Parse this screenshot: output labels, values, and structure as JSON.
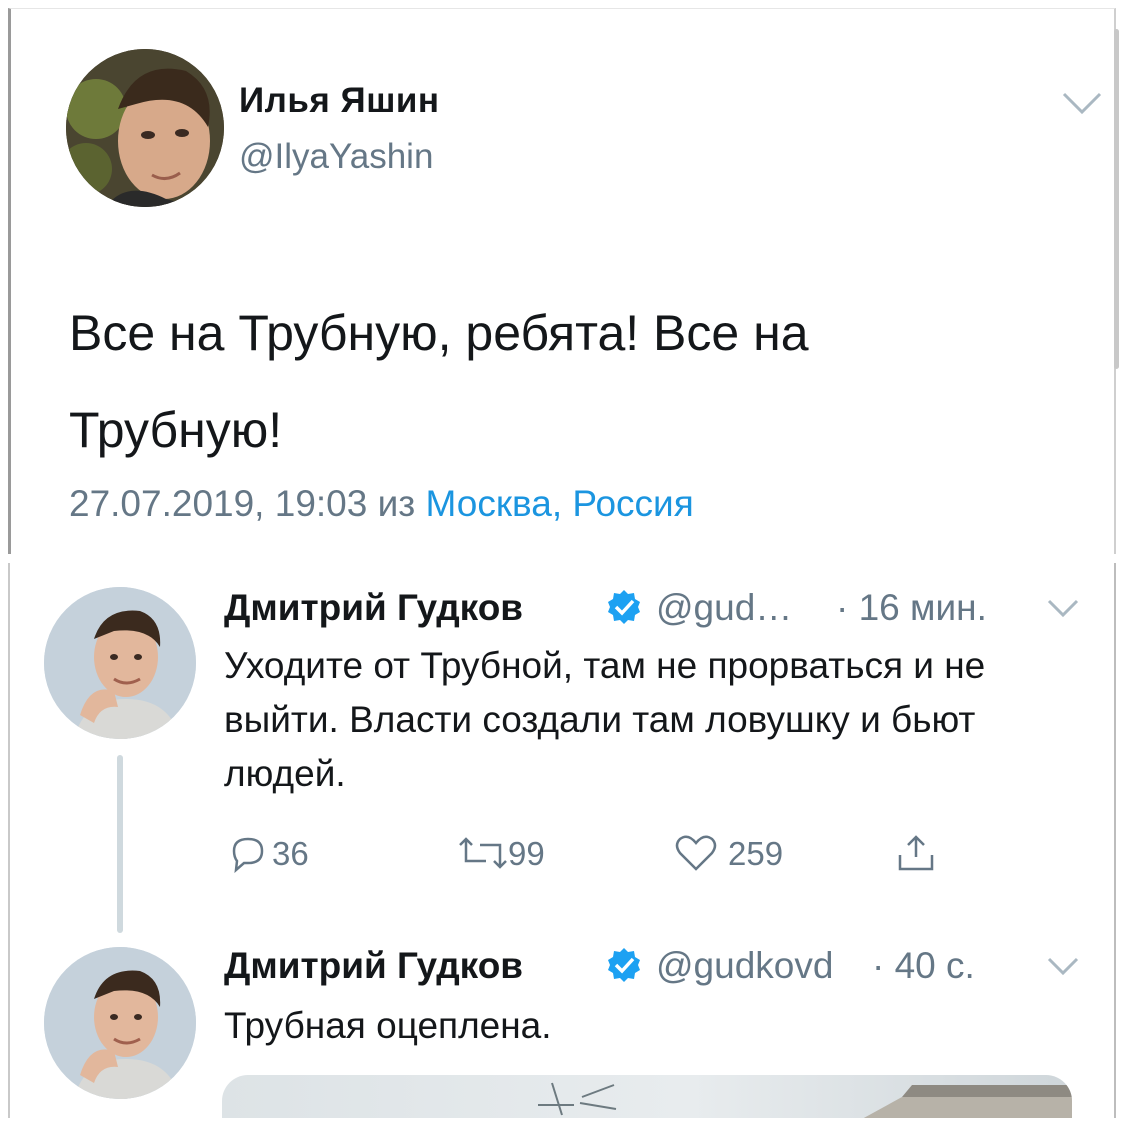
{
  "top_tweet": {
    "name": "Илья Яшин",
    "handle": "@IlyaYashin",
    "text": "Все на Трубную, ребята! Все на Трубную!",
    "timestamp": "27.07.2019, 19:03",
    "from_word": "из",
    "location": "Москва, Россия",
    "colors": {
      "link": "#1b95e0",
      "muted": "#657786"
    }
  },
  "thread": [
    {
      "name": "Дмитрий Гудков",
      "handle": "@gud…",
      "time": "· 16 мин.",
      "text": "Уходите от Трубной, там не прорваться и не выйти. Власти создали там ловушку и бьют людей.",
      "replies": "36",
      "retweets": "99",
      "likes": "259"
    },
    {
      "name": "Дмитрий Гудков",
      "handle": "@gudkovd",
      "time": "· 40 с.",
      "text": "Трубная оцеплена."
    }
  ],
  "icons": [
    "chevron-down-icon",
    "verified-badge-icon",
    "reply-icon",
    "retweet-icon",
    "like-icon",
    "share-icon"
  ]
}
